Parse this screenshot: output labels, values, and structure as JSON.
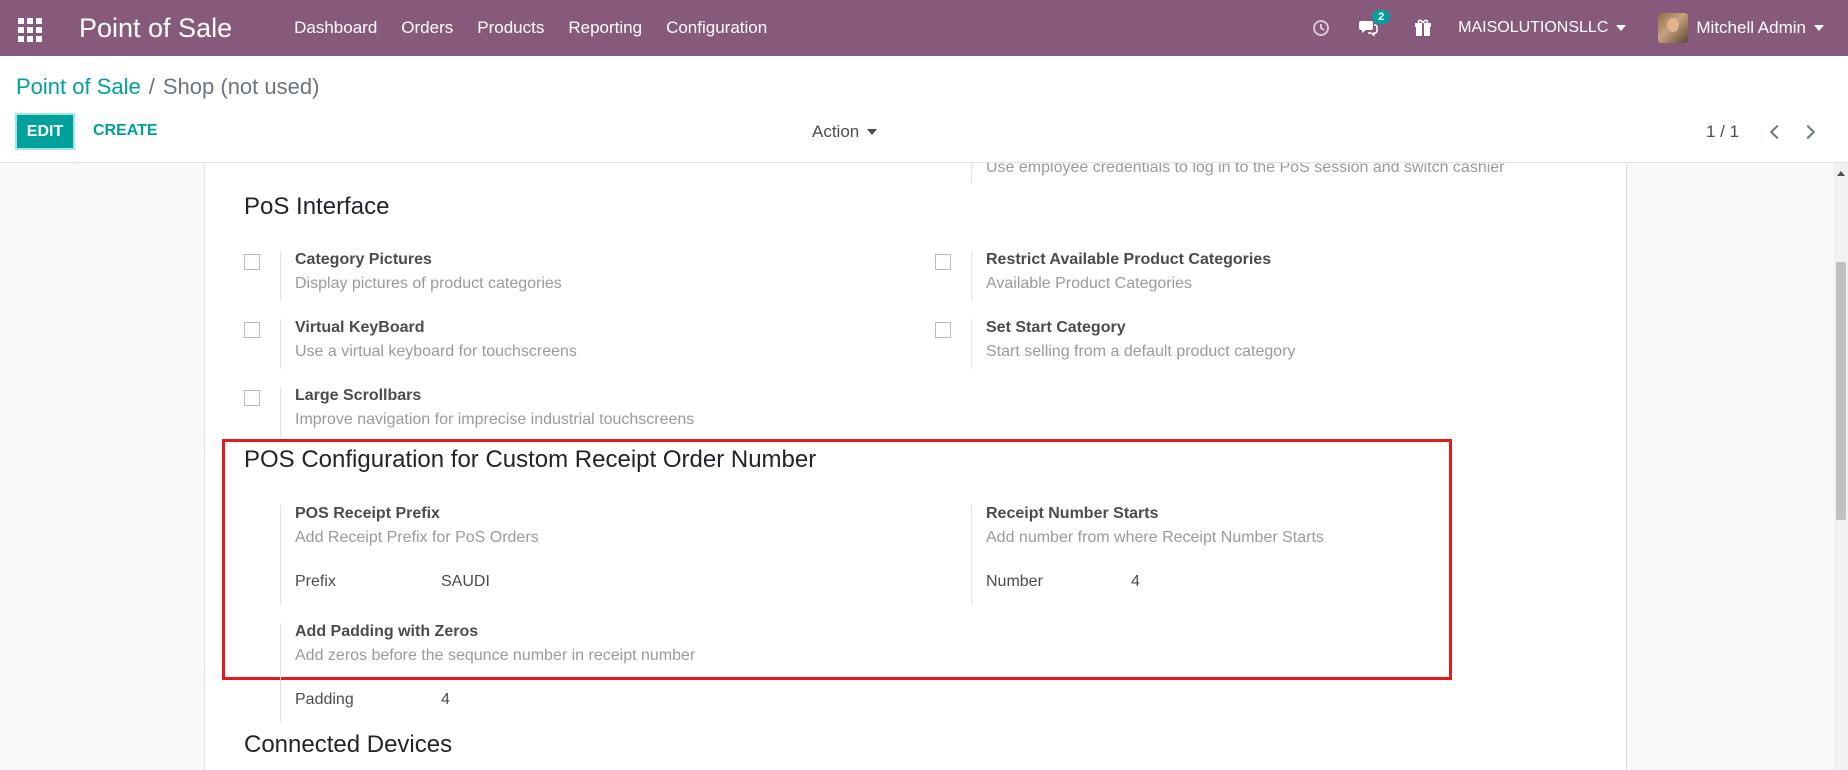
{
  "navbar": {
    "app_title": "Point of Sale",
    "menu": [
      "Dashboard",
      "Orders",
      "Products",
      "Reporting",
      "Configuration"
    ],
    "chat_count": "2",
    "company": "MAISOLUTIONSLLC",
    "user": "Mitchell Admin"
  },
  "control_panel": {
    "breadcrumb_parent": "Point of Sale",
    "breadcrumb_sep": "/",
    "breadcrumb_current": "Shop (not used)",
    "edit_label": "EDIT",
    "create_label": "CREATE",
    "action_label": "Action",
    "pager": "1 / 1"
  },
  "sheet": {
    "top_partial_desc": "Use employee credentials to log in to the PoS session and switch cashier",
    "pos_interface": {
      "title": "PoS Interface",
      "settings": [
        {
          "label": "Category Pictures",
          "desc": "Display pictures of product categories"
        },
        {
          "label": "Restrict Available Product Categories",
          "desc": "Available Product Categories"
        },
        {
          "label": "Virtual KeyBoard",
          "desc": "Use a virtual keyboard for touchscreens"
        },
        {
          "label": "Set Start Category",
          "desc": "Start selling from a default product category"
        },
        {
          "label": "Large Scrollbars",
          "desc": "Improve navigation for imprecise industrial touchscreens"
        }
      ]
    },
    "receipt_config": {
      "title": "POS Configuration for Custom Receipt Order Number",
      "prefix": {
        "label": "POS Receipt Prefix",
        "desc": "Add Receipt Prefix for PoS Orders",
        "field_label": "Prefix",
        "field_value": "SAUDI"
      },
      "number": {
        "label": "Receipt Number Starts",
        "desc": "Add number from where Receipt Number Starts",
        "field_label": "Number",
        "field_value": "4"
      },
      "padding": {
        "label": "Add Padding with Zeros",
        "desc": "Add zeros before the sequnce number in receipt number",
        "field_label": "Padding",
        "field_value": "4"
      }
    },
    "connected_devices": {
      "title": "Connected Devices"
    }
  },
  "colors": {
    "navbar": "#875a7b",
    "accent": "#00a09d",
    "highlight_border": "#e31b1b"
  }
}
